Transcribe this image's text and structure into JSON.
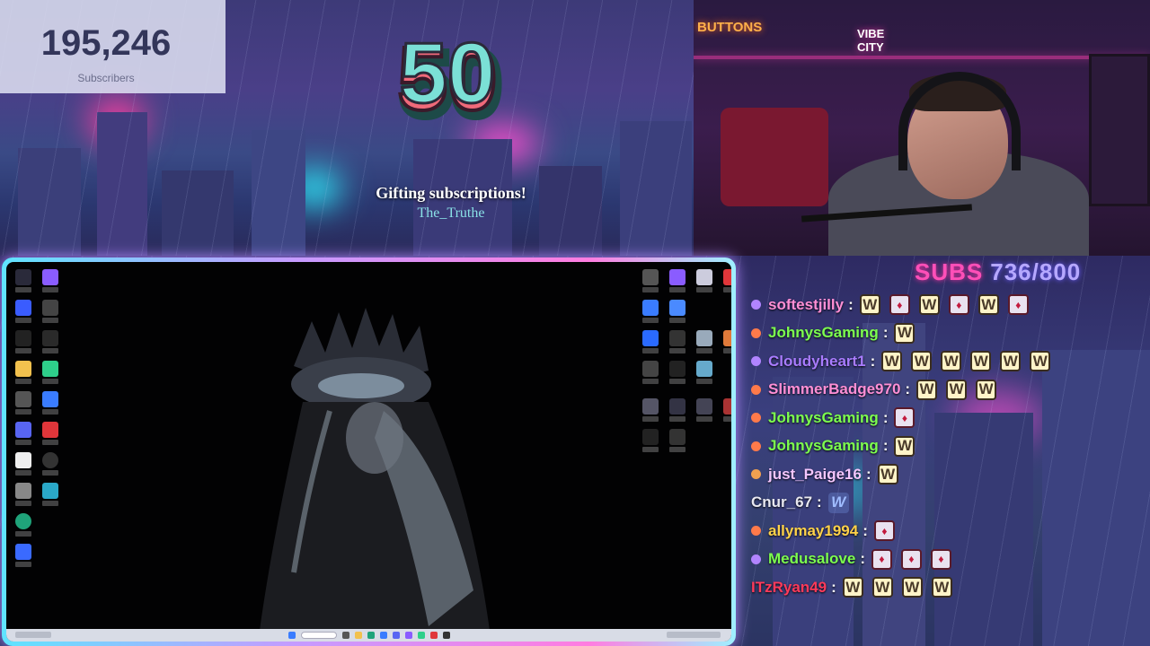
{
  "counter": {
    "value": "195,246",
    "label": "Subscribers"
  },
  "alert": {
    "gift_count": "50",
    "title": "Gifting subscriptions!",
    "user": "The_Truthe"
  },
  "webcam": {
    "sign_left": "BUTTONS",
    "sign_right": "VIBE CITY"
  },
  "subs_goal": {
    "label": "SUBS",
    "progress": "736/800",
    "current": 736,
    "target": 800
  },
  "chat": [
    {
      "user": "softestjilly",
      "color": "#ff8fd6",
      "badge": "#b184ff",
      "emotes": [
        "W",
        "K",
        "W",
        "K",
        "W",
        "K"
      ]
    },
    {
      "user": "JohnysGaming",
      "color": "#7dff4f",
      "badge": "#ff7a4a",
      "emotes": [
        "W"
      ]
    },
    {
      "user": "Cloudyheart1",
      "color": "#a97cff",
      "badge": "#b184ff",
      "emotes": [
        "W",
        "W",
        "W",
        "W",
        "W",
        "W"
      ]
    },
    {
      "user": "SlimmerBadge970",
      "color": "#ff8fd6",
      "badge": "#ff7a4a",
      "emotes": [
        "W",
        "W",
        "W"
      ]
    },
    {
      "user": "JohnysGaming",
      "color": "#7dff4f",
      "badge": "#ff7a4a",
      "emotes": [
        "K"
      ]
    },
    {
      "user": "JohnysGaming",
      "color": "#7dff4f",
      "badge": "#ff7a4a",
      "emotes": [
        "W"
      ]
    },
    {
      "user": "just_Paige16",
      "color": "#f4c6ff",
      "badge": "#f0a050",
      "emotes": [
        "W"
      ]
    },
    {
      "user": "Cnur_67",
      "color": "#e8e8f0",
      "badge": "",
      "emotes": [
        "V"
      ]
    },
    {
      "user": "allymay1994",
      "color": "#ffd24a",
      "badge": "#ff7a4a",
      "emotes": [
        "K"
      ]
    },
    {
      "user": "Medusalove",
      "color": "#7dff4f",
      "badge": "#b184ff",
      "emotes": [
        "K",
        "K",
        "K"
      ]
    },
    {
      "user": "ITzRyan49",
      "color": "#ff3a5a",
      "badge": "",
      "emotes": [
        "W",
        "W",
        "W",
        "W"
      ]
    }
  ],
  "colors": {
    "accent_pink": "#ff4fb8",
    "accent_cyan": "#5fe4ff",
    "goal_purple": "#b6a8ff"
  }
}
